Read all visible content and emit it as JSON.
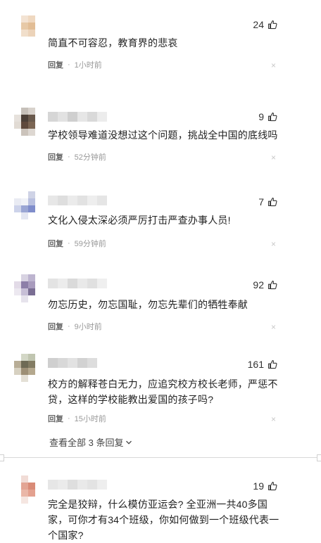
{
  "comments": [
    {
      "likes": "24",
      "text": "简直不可容忍，教育界的悲哀",
      "reply": "回复",
      "time": "1小时前",
      "name_colors": [],
      "avatar": [
        "#ffffff",
        "#f3e3d3",
        "#efd8c0",
        "#ffffff",
        "#ffffff",
        "#e7c9a7",
        "#e2bd95",
        "#ffffff",
        "#ffffff",
        "#f1dfcb",
        "#ecd3b9",
        "#ffffff",
        "#ffffff",
        "#ffffff",
        "#ffffff",
        "#ffffff"
      ]
    },
    {
      "likes": "9",
      "text": "学校领导难道没想过这个问题，挑战全中国的底线吗",
      "reply": "回复",
      "time": "52分钟前",
      "name_colors": [
        "#d6d6d6",
        "#e2e2e2",
        "#cfcfcf",
        "#e6e6e6",
        "#d9d9d9",
        "#ececec"
      ],
      "avatar": [
        "#ffffff",
        "#c6c0b9",
        "#d8d2cc",
        "#ffffff",
        "#e6e1dc",
        "#4c4038",
        "#6a5a4d",
        "#ffffff",
        "#e1dbd4",
        "#5f4a3d",
        "#7b6553",
        "#ffffff",
        "#ffffff",
        "#cbc3bb",
        "#ddd7d1",
        "#ffffff"
      ]
    },
    {
      "likes": "7",
      "text": "文化入侵太深必须严厉打击严查办事人员!",
      "reply": "回复",
      "time": "59分钟前",
      "name_colors": [
        "#e7e7e7",
        "#dedede",
        "#ebebeb",
        "#e2e2e2",
        "#eeeeee",
        "#e5e5e5"
      ],
      "avatar": [
        "#ffffff",
        "#ffffff",
        "#cfd3e6",
        "#ffffff",
        "#e9ebf3",
        "#f0f2f7",
        "#b9c0df",
        "#ffffff",
        "#cdd3ea",
        "#9aa6d4",
        "#7f8dcb",
        "#ffffff",
        "#ffffff",
        "#e3e6f2",
        "#ffffff",
        "#ffffff"
      ]
    },
    {
      "likes": "92",
      "text": "勿忘历史，勿忘国耻，勿忘先辈们的牺牲奉献",
      "reply": "回复",
      "time": "9小时前",
      "name_colors": [
        "#e3e3e3",
        "#ececec",
        "#dadada",
        "#e9e9e9",
        "#e0e0e0",
        "#efefef"
      ],
      "avatar": [
        "#ffffff",
        "#d8d3e2",
        "#bdb4cf",
        "#ffffff",
        "#e2dbe7",
        "#8d7fa8",
        "#a89bbd",
        "#ffffff",
        "#ece8f0",
        "#c7bfd6",
        "#7a6e93",
        "#ffffff",
        "#ffffff",
        "#e6e3ec",
        "#ffffff",
        "#ffffff"
      ]
    },
    {
      "likes": "161",
      "text": "校方的解释苍白无力，应追究校方校长老师，严惩不贷，这样的学校能教出爱国的孩子吗?",
      "reply": "回复",
      "time": "15小时前",
      "name_colors": [
        "#cfcfcf",
        "#d8d8d8",
        "#e2e2e2",
        "#d2d2d2",
        "#dddddd"
      ],
      "avatar": [
        "#ffffff",
        "#d3d7c6",
        "#c0c5b0",
        "#ffffff",
        "#b8ad96",
        "#6e6a55",
        "#837c63",
        "#ffffff",
        "#d7d1c1",
        "#9d8f76",
        "#b4a88e",
        "#ffffff",
        "#ffffff",
        "#e4e0d6",
        "#ffffff",
        "#ffffff"
      ]
    },
    {
      "likes": "19",
      "text": "完全是狡辩，什么模仿亚运会? 全亚洲一共40多国家，可你才有34个班级，你如何做到一个班级代表一个国家?",
      "name_colors": [
        "#e6e6e6",
        "#ebebeb",
        "#dedede",
        "#e9e9e9",
        "#e3e3e3",
        "#eeeeee"
      ],
      "avatar": [
        "#ffffff",
        "#f1dcd6",
        "#ffffff",
        "#ffffff",
        "#ffffff",
        "#e3a594",
        "#d98b77",
        "#ffffff",
        "#ffffff",
        "#eab7a8",
        "#e3a18f",
        "#ffffff",
        "#ffffff",
        "#f5e6e1",
        "#ffffff",
        "#ffffff"
      ]
    }
  ],
  "view_all": "查看全部 3 条回复",
  "colors": {
    "text": "#222222",
    "meta": "#999999",
    "reply": "#666666"
  }
}
